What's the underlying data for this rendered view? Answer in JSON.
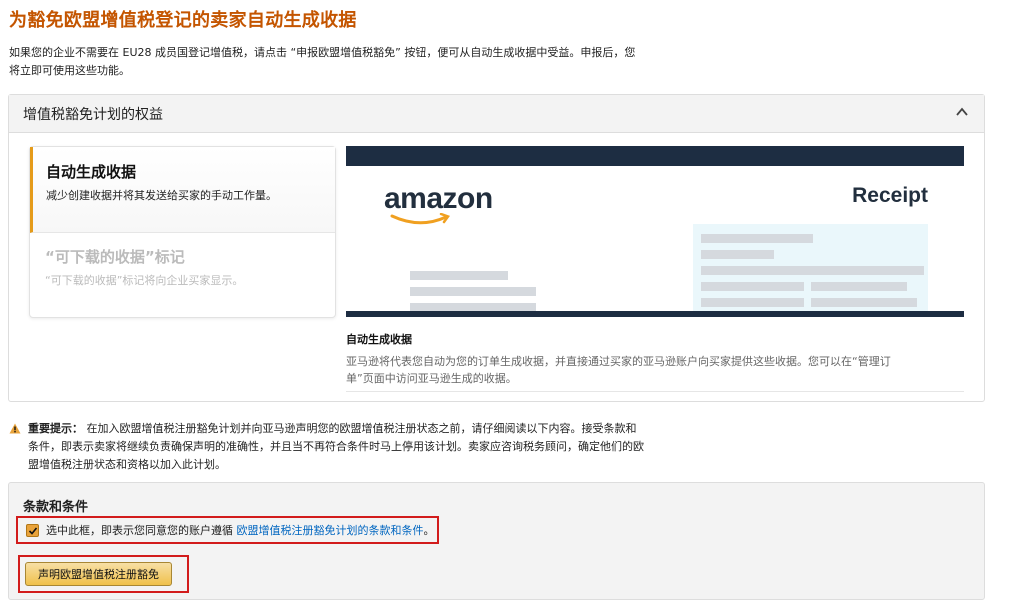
{
  "page": {
    "title": "为豁免欧盟增值税登记的卖家自动生成收据",
    "intro_line1": "如果您的企业不需要在 EU28 成员国登记增值税，请点击 “申报欧盟增值税豁免” 按钮，便可从自动生成收据中受益。申报后，您",
    "intro_line2": "将立即可使用这些功能。"
  },
  "benefits": {
    "title": "增值税豁免计划的权益",
    "collapse_icon": "chevron-up-icon",
    "features": [
      {
        "name": "自动生成收据",
        "desc": "减少创建收据并将其发送给买家的手动工作量。",
        "active": true
      },
      {
        "name": "“可下载的收据”标记",
        "desc": "“可下载的收据”标记将向企业买家显示。",
        "active": false
      }
    ],
    "preview": {
      "logo_text": "amazon",
      "receipt_text": "Receipt",
      "colors": {
        "navy": "#1d2d42",
        "smile": "#f0a020",
        "panel": "#eaf7fb",
        "placeholder": "#d5d9de"
      }
    },
    "caption_title": "自动生成收据",
    "caption_line1": "亚马逊将代表您自动为您的订单生成收据，并直接通过买家的亚马逊账户向买家提供这些收据。您可以在“管理订",
    "caption_line2": "单”页面中访问亚马逊生成的收据。"
  },
  "notice": {
    "icon": "warning-icon",
    "label": "重要提示：",
    "line1": "在加入欧盟增值税注册豁免计划并向亚马逊声明您的欧盟增值税注册状态之前，请仔细阅读以下内容。接受条款和",
    "line2": "条件，即表示卖家将继续负责确保声明的准确性，并且当不再符合条件时马上停用该计划。卖家应咨询税务顾问，确定他们的欧",
    "line3": "盟增值税注册状态和资格以加入此计划。"
  },
  "terms": {
    "title": "条款和条件",
    "checked": true,
    "agree_prefix": "选中此框，即表示您同意您的账户遵循 ",
    "agree_link": "欧盟增值税注册豁免计划的条款和条件",
    "agree_suffix": "。",
    "declare_button": "声明欧盟增值税注册豁免",
    "colors": {
      "accent": "#c45500",
      "link": "#0066c0",
      "highlight": "#d21b1b",
      "button": "#f0c14b"
    }
  }
}
